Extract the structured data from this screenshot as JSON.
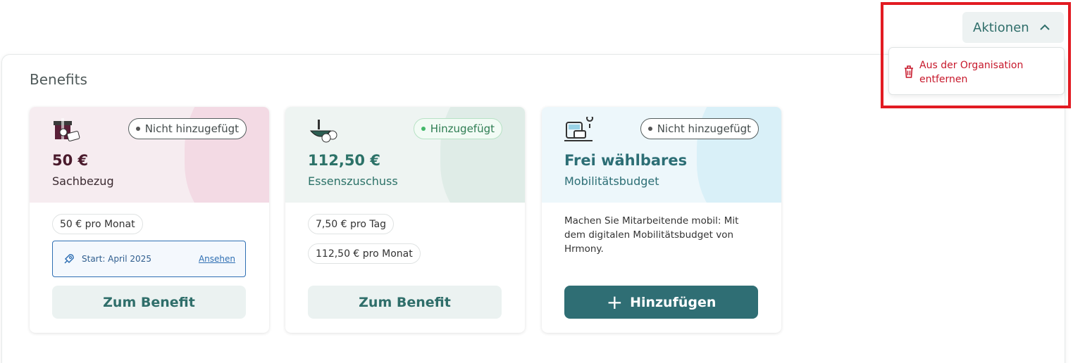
{
  "section": {
    "title": "Benefits"
  },
  "actions": {
    "label": "Aktionen",
    "menu_items": [
      {
        "label": "Aus der Organisation entfernen",
        "icon": "trash-icon"
      }
    ]
  },
  "cards": [
    {
      "status": "Nicht hinzugefügt",
      "amount": "50 €",
      "subtitle": "Sachbezug",
      "chips": [
        "50 € pro Monat"
      ],
      "start": {
        "text": "Start: April 2025",
        "link": "Ansehen"
      },
      "button": "Zum Benefit"
    },
    {
      "status": "Hinzugefügt",
      "amount": "112,50 €",
      "subtitle": "Essenszuschuss",
      "chips": [
        "7,50 € pro Tag",
        "112,50 € pro Monat"
      ],
      "button": "Zum Benefit"
    },
    {
      "status": "Nicht hinzugefügt",
      "amount": "Frei wählbares",
      "subtitle": "Mobilitätsbudget",
      "description": "Machen Sie Mitarbeitende mobil: Mit dem digitalen Mobilitätsbudget von Hrmony.",
      "button": "Hinzufügen"
    }
  ],
  "colors": {
    "accent": "#2f6e74",
    "danger": "#c7182b",
    "highlight": "#e21b22"
  }
}
